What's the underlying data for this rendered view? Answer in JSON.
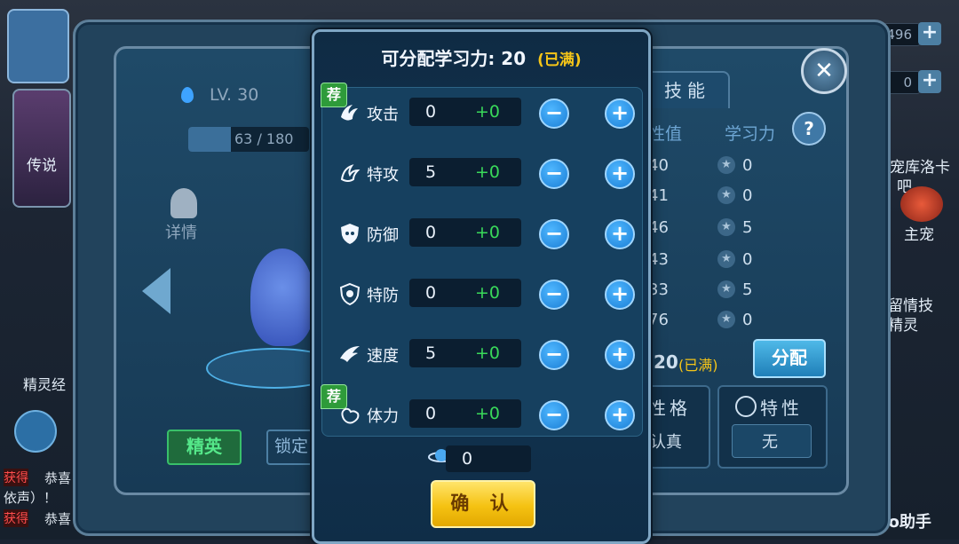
{
  "resources": {
    "top_value": "496",
    "second_value": "0",
    "plus": "+"
  },
  "close_glyph": "✕",
  "left_panel": {
    "level": "LV. 30",
    "exp": "63 / 180",
    "legend_label": "传说",
    "details_label": "详情",
    "elite_exp_label": "精灵经",
    "elite_tab": "精英",
    "lock_tab": "锁定"
  },
  "right_panel": {
    "skills_tab": "技能",
    "col_value": "性值",
    "col_learning": "学习力",
    "help": "?",
    "values": [
      "40",
      "41",
      "46",
      "43",
      "33",
      "76"
    ],
    "learning": [
      "0",
      "0",
      "5",
      "0",
      "5",
      "0"
    ],
    "remaining": "20",
    "full_tag": "(已满)",
    "assign_button": "分配",
    "nature_label": "性格",
    "nature_value": "认真",
    "trait_label": "特性",
    "trait_value": "无"
  },
  "side": {
    "text1": "宠库洛卡",
    "text1b": "吧",
    "main_pet": "主宠",
    "leave": "留情技",
    "spirit": "精灵",
    "helper": "NoNo助手"
  },
  "chat": {
    "line1_tag": "获得",
    "line1": "恭喜",
    "line2": "依声）！",
    "line3_tag": "获得",
    "line3": "恭喜"
  },
  "popup": {
    "title": "可分配学习力:",
    "points": "20",
    "full_tag": "(已满)",
    "rows": [
      {
        "label": "攻击",
        "value": "0",
        "added": "+0",
        "recommended": true
      },
      {
        "label": "特攻",
        "value": "5",
        "added": "+0",
        "recommended": false
      },
      {
        "label": "防御",
        "value": "0",
        "added": "+0",
        "recommended": false
      },
      {
        "label": "特防",
        "value": "0",
        "added": "+0",
        "recommended": false
      },
      {
        "label": "速度",
        "value": "5",
        "added": "+0",
        "recommended": false
      },
      {
        "label": "体力",
        "value": "0",
        "added": "+0",
        "recommended": true
      }
    ],
    "recommend_tag": "荐",
    "minus": "−",
    "plus": "+",
    "item_count": "0",
    "confirm": "确 认"
  }
}
